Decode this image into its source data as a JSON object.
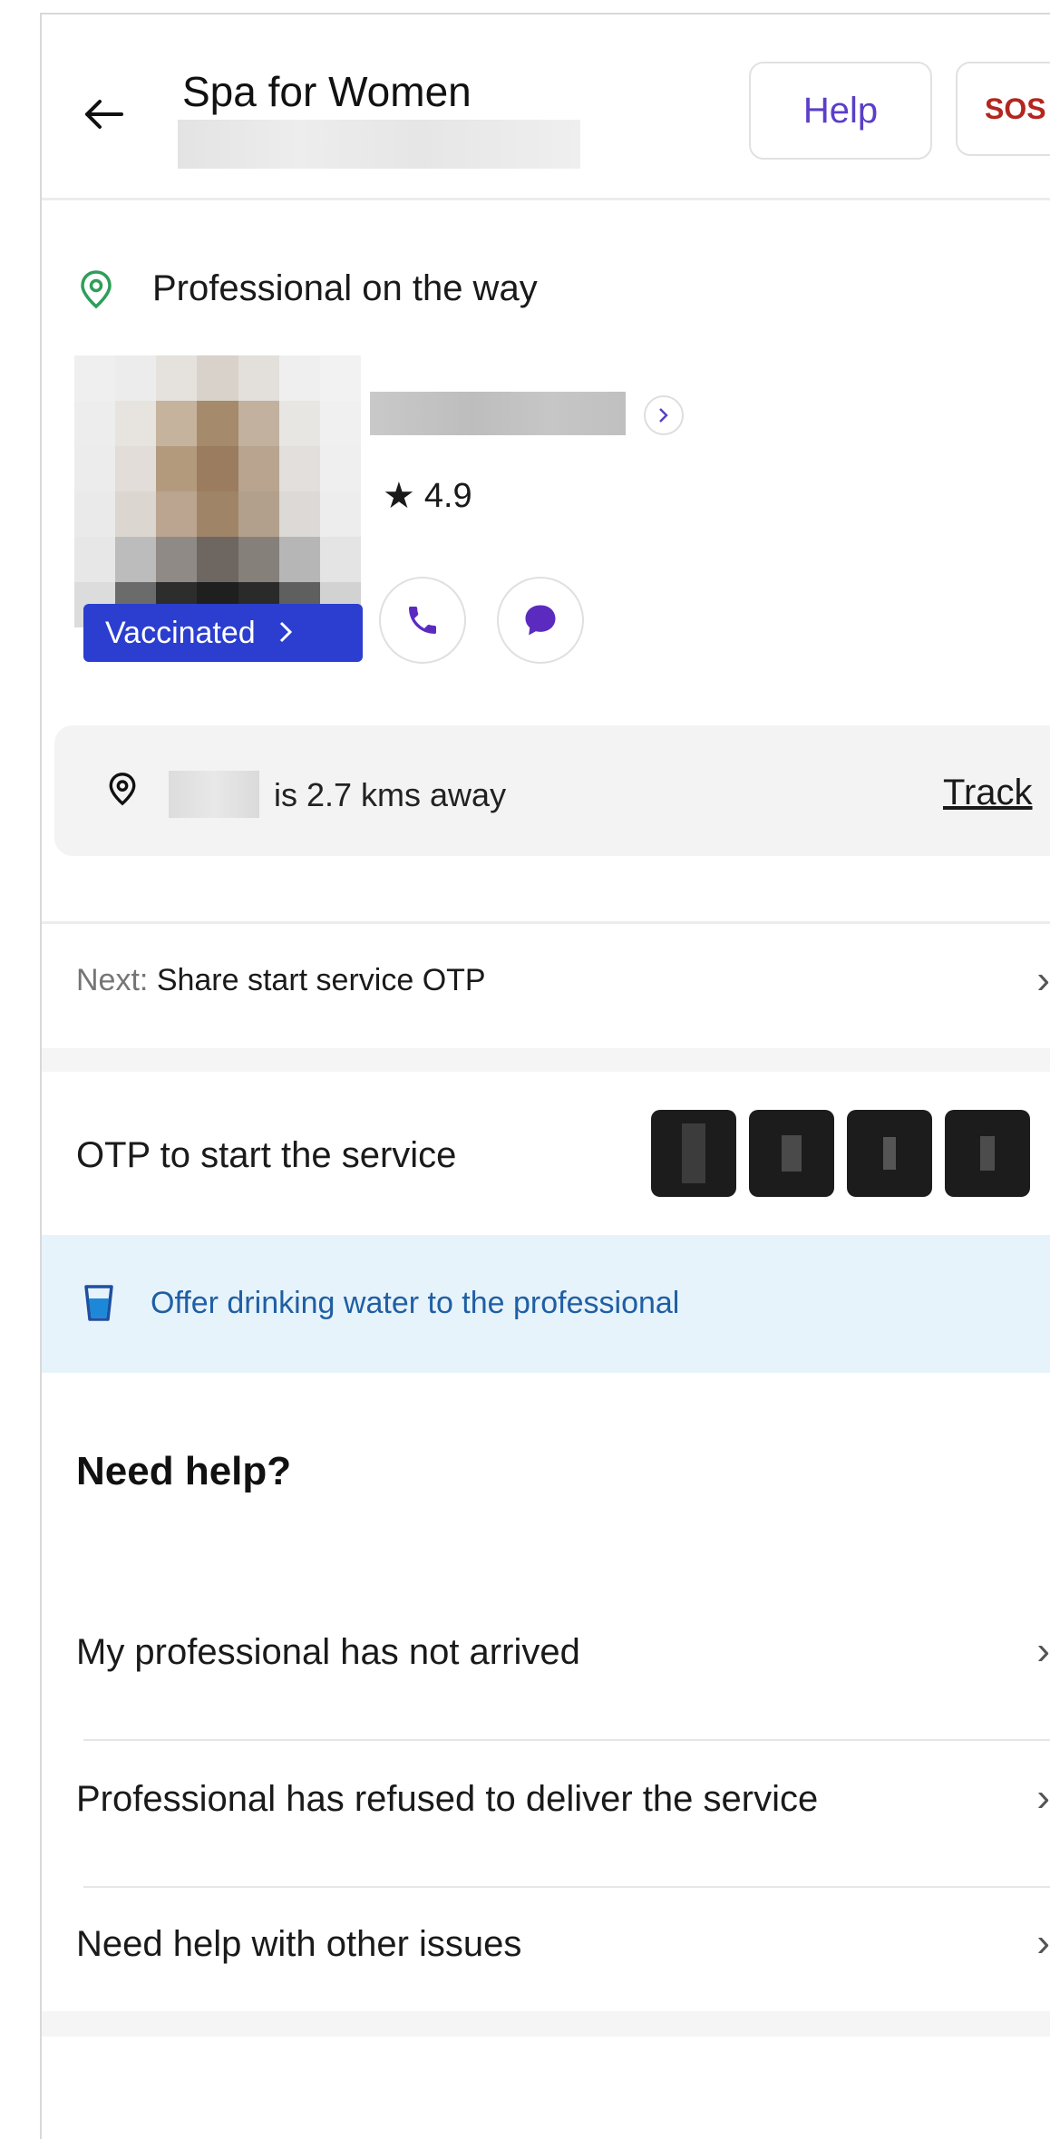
{
  "header": {
    "title": "Spa for Women",
    "help_label": "Help",
    "sos_label": "SOS"
  },
  "status": {
    "text": "Professional on the way"
  },
  "professional": {
    "badge_label": "Vaccinated",
    "rating": "4.9"
  },
  "distance": {
    "text": "is 2.7 kms away",
    "track_label": "Track"
  },
  "next_step": {
    "label": "Next:",
    "text": "Share start service OTP"
  },
  "otp": {
    "label": "OTP to start the service"
  },
  "banner": {
    "text": "Offer drinking water to the professional"
  },
  "need_help": {
    "heading": "Need help?",
    "items": [
      {
        "label": "My professional has not arrived"
      },
      {
        "label": "Professional has refused to deliver the service"
      },
      {
        "label": "Need help with other issues"
      }
    ]
  },
  "colors": {
    "accent_purple": "#5b3ec9",
    "sos_red": "#b3261e",
    "badge_blue": "#2b3ecf",
    "banner_bg": "#e7f3fb",
    "banner_text": "#1f5fa3",
    "status_green": "#2e9e5b"
  },
  "icons": {
    "back": "arrow-left-icon",
    "status": "location-pin-icon",
    "call": "phone-icon",
    "chat": "chat-bubble-icon",
    "water": "glass-icon",
    "chevron": "chevron-right-icon"
  }
}
